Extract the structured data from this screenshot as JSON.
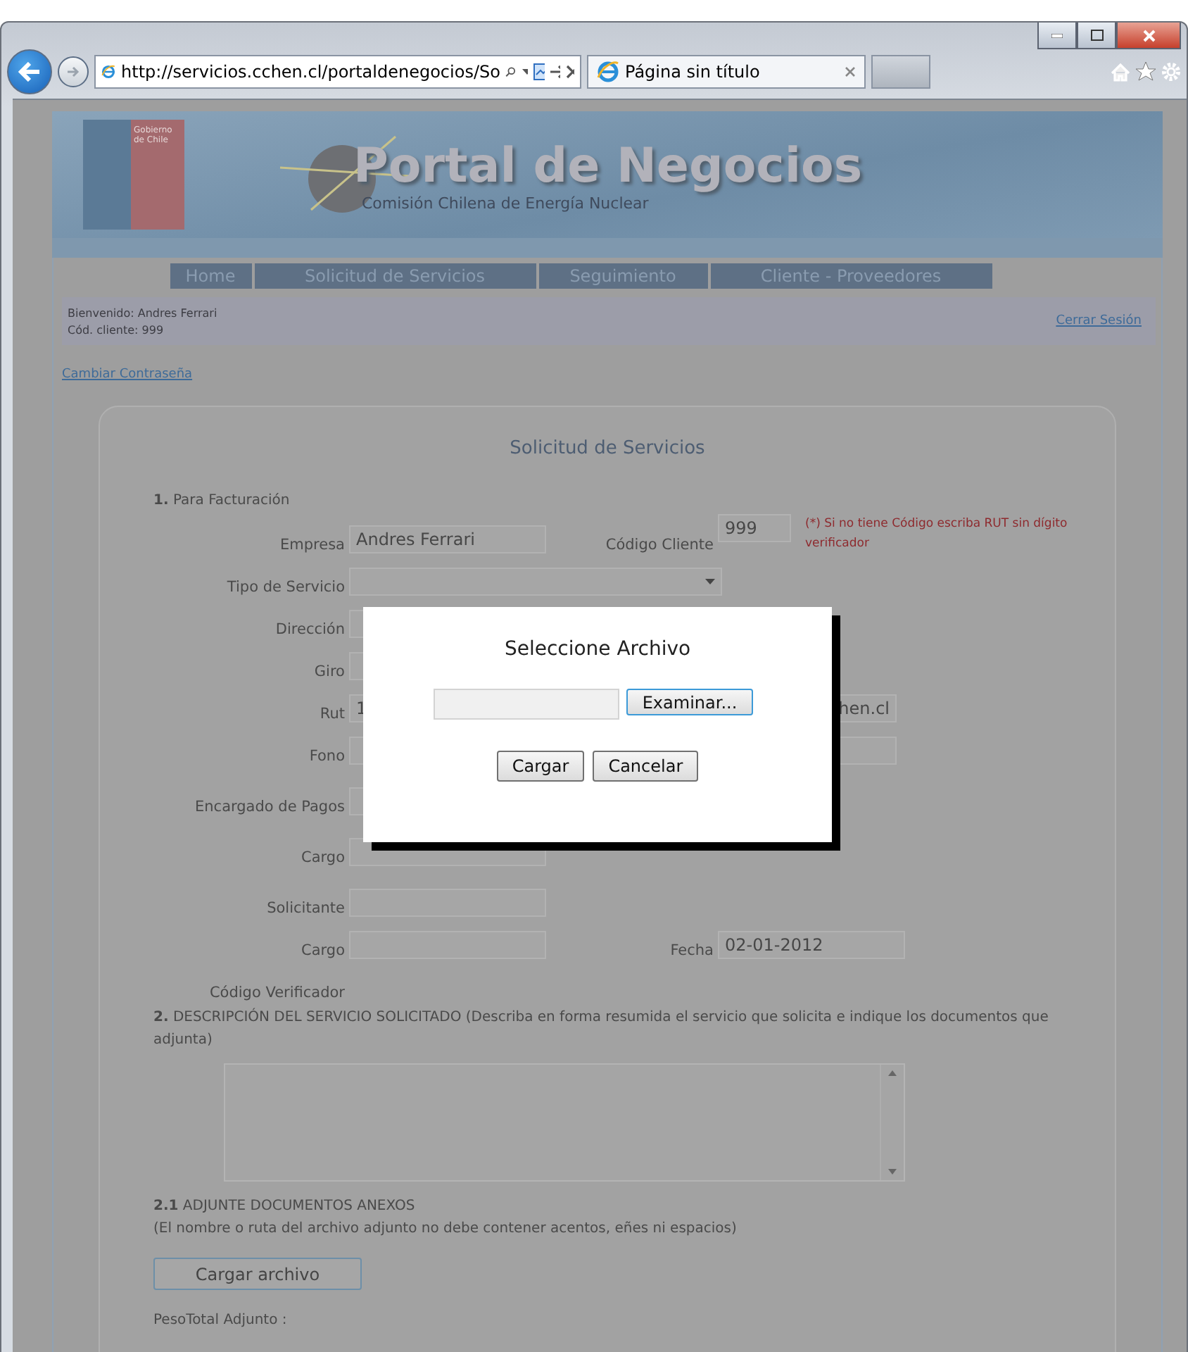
{
  "browser": {
    "address": "http://servicios.cchen.cl/portaldenegocios/So",
    "tab_title": "Página sin título"
  },
  "header": {
    "logo_text": "Gobierno de Chile",
    "title": "Portal de Negocios",
    "subtitle": "Comisión Chilena de Energía Nuclear"
  },
  "nav": [
    "Home",
    "Solicitud de Servicios",
    "Seguimiento",
    "Cliente - Proveedores"
  ],
  "welcome": {
    "greeting": "Bienvenido: Andres Ferrari",
    "client_code": "Cód. cliente: 999",
    "logout": "Cerrar Sesión"
  },
  "change_password": "Cambiar Contraseña",
  "form": {
    "title": "Solicitud de Servicios",
    "section_1": "**1.** Para Facturación",
    "rows": [
      {
        "kind": "text",
        "label": "Empresa",
        "value": "Andres Ferrari",
        "right": {
          "label": "Código Cliente",
          "value": "999",
          "note": "(*) Si no tiene Código escriba RUT sin dígito verificador"
        }
      },
      {
        "kind": "select",
        "label": "Tipo de Servicio"
      },
      {
        "kind": "text",
        "label": "Dirección"
      },
      {
        "kind": "text",
        "label": "Giro"
      },
      {
        "kind": "text",
        "label": "Rut",
        "value": "1",
        "right": {
          "value": "hen.cl"
        }
      },
      {
        "kind": "text",
        "label": "Fono",
        "right": {}
      },
      {
        "kind": "text",
        "label": "Encargado de Pagos"
      },
      {
        "kind": "text",
        "label": "Cargo"
      },
      {
        "kind": "text",
        "label": "Solicitante"
      },
      {
        "kind": "text",
        "label": "Cargo",
        "right": {
          "label": "Fecha",
          "value": "02-01-2012"
        }
      },
      {
        "kind": "label",
        "label": "Código Verificador"
      }
    ],
    "section_2": "**2.** DESCRIPCIÓN DEL SERVICIO SOLICITADO (Describa en forma resumida el servicio que solicita e indique los documentos que adjunta)",
    "section_2_1": "**2.1** ADJUNTE DOCUMENTOS ANEXOS",
    "section_2_1_note": "(El nombre o ruta del archivo adjunto no debe contener acentos, eñes ni espacios)",
    "upload_button": "Cargar archivo",
    "total": "PesoTotal Adjunto :"
  },
  "modal": {
    "title": "Seleccione Archivo",
    "browse_button": "Examinar...",
    "buttons": [
      "Cargar",
      "Cancelar"
    ]
  }
}
